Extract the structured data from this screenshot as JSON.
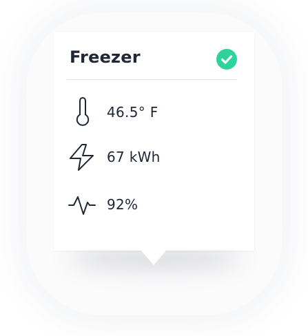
{
  "card": {
    "title": "Freezer",
    "status_icon": "check-circle-icon",
    "status_color": "#2ed39a"
  },
  "metrics": [
    {
      "icon": "thermometer-icon",
      "value": "46.5° F"
    },
    {
      "icon": "lightning-bolt-icon",
      "value": "67 kWh"
    },
    {
      "icon": "pulse-wave-icon",
      "value": "92%"
    }
  ],
  "colors": {
    "text": "#1f2634",
    "divider": "#e3e5ea"
  }
}
